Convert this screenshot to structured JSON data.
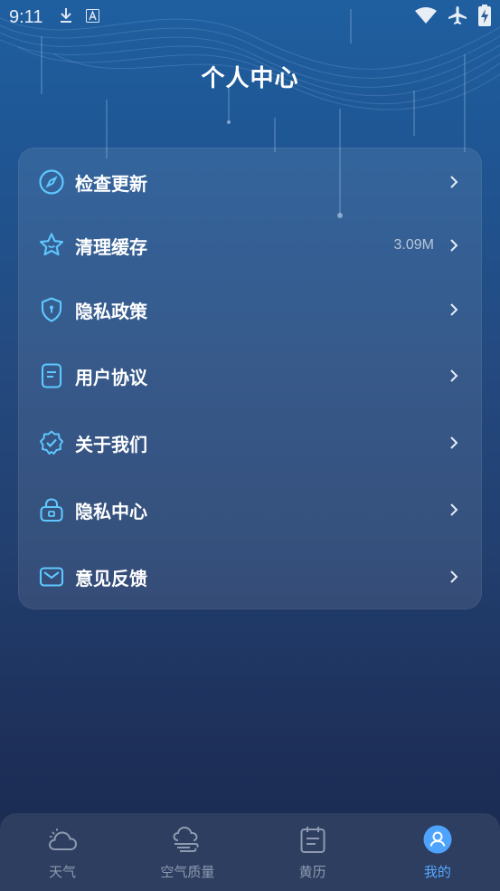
{
  "status_bar": {
    "time": "9:11",
    "left_icons": [
      "download-icon",
      "a-icon"
    ],
    "right_icons": [
      "wifi-icon",
      "airplane-icon",
      "battery-charging-icon"
    ]
  },
  "header": {
    "title": "个人中心"
  },
  "menu": {
    "items": [
      {
        "id": "check-update",
        "label": "检查更新",
        "icon": "compass-icon",
        "value": ""
      },
      {
        "id": "clear-cache",
        "label": "清理缓存",
        "icon": "star-icon",
        "value": "3.09M"
      },
      {
        "id": "privacy-policy",
        "label": "隐私政策",
        "icon": "shield-icon",
        "value": ""
      },
      {
        "id": "user-agreement",
        "label": "用户协议",
        "icon": "document-icon",
        "value": ""
      },
      {
        "id": "about-us",
        "label": "关于我们",
        "icon": "badge-check-icon",
        "value": ""
      },
      {
        "id": "privacy-center",
        "label": "隐私中心",
        "icon": "lock-icon",
        "value": ""
      },
      {
        "id": "feedback",
        "label": "意见反馈",
        "icon": "mail-icon",
        "value": ""
      }
    ]
  },
  "tabs": [
    {
      "label": "天气",
      "icon": "cloud-sun-icon",
      "active": false
    },
    {
      "label": "空气质量",
      "icon": "wind-cloud-icon",
      "active": false
    },
    {
      "label": "黄历",
      "icon": "calendar-icon",
      "active": false
    },
    {
      "label": "我的",
      "icon": "user-icon",
      "active": true
    }
  ],
  "colors": {
    "accent": "#58a8ff",
    "icon_stroke": "#5ec8ff",
    "tab_inactive": "#8e9ab0",
    "tab_bar_bg": "#2d3e60"
  }
}
